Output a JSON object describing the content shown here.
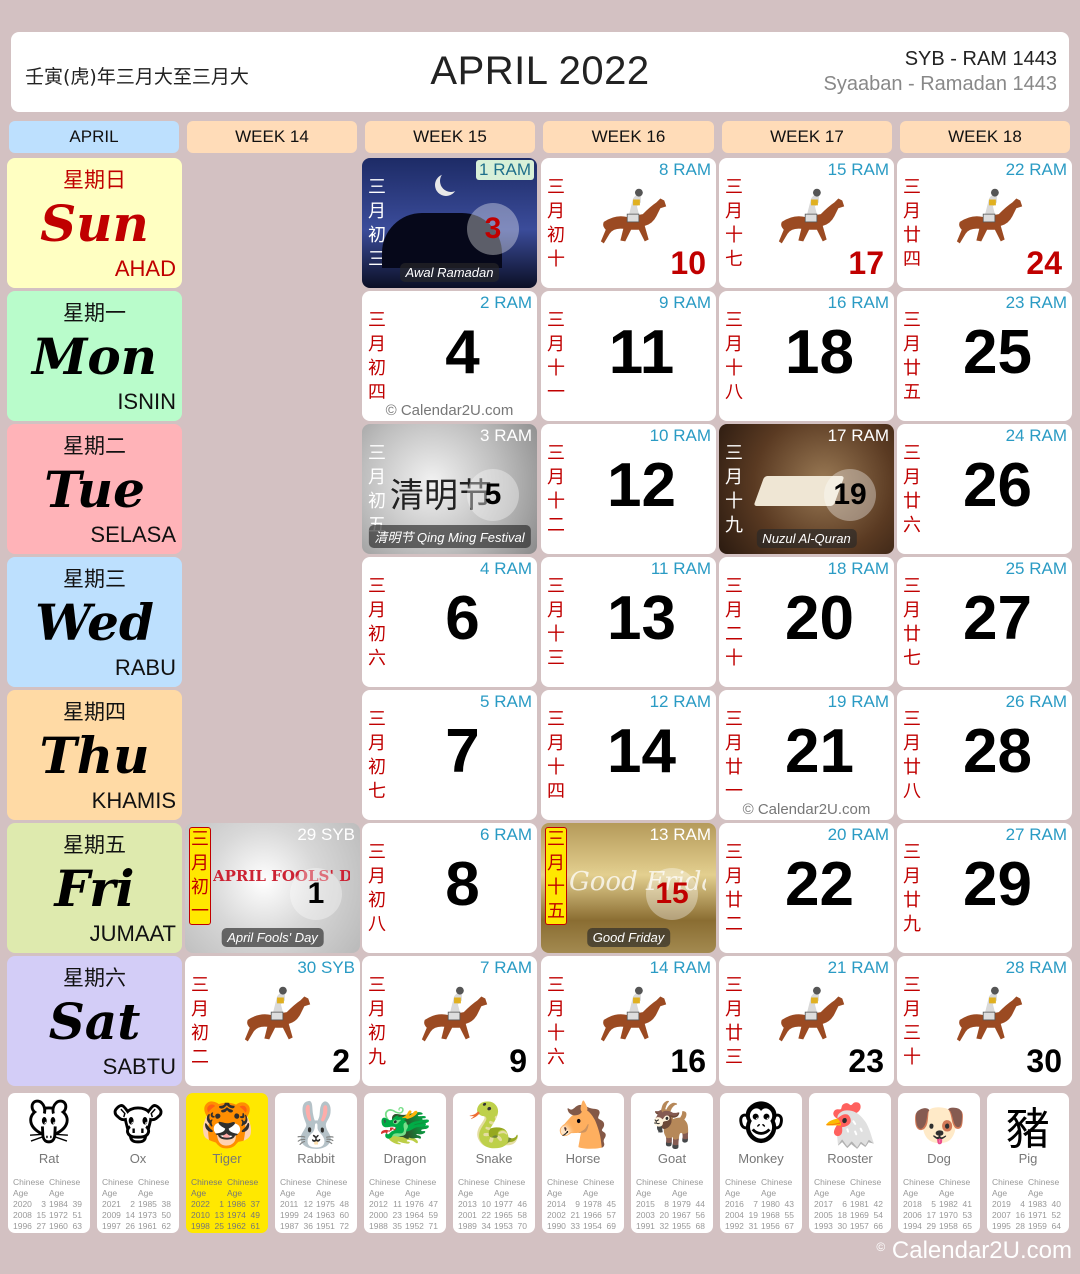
{
  "header": {
    "chinese_year": "壬寅(虎)年三月大至三月大",
    "title": "APRIL 2022",
    "hijri_short": "SYB - RAM 1443",
    "hijri_long": "Syaaban - Ramadan 1443"
  },
  "columns": [
    "APRIL",
    "WEEK 14",
    "WEEK 15",
    "WEEK 16",
    "WEEK 17",
    "WEEK 18"
  ],
  "days": [
    {
      "cn": "星期日",
      "en": "Sun",
      "ms": "AHAD",
      "color": "#ffffc2"
    },
    {
      "cn": "星期一",
      "en": "Mon",
      "ms": "ISNIN",
      "color": "#b9fccb"
    },
    {
      "cn": "星期二",
      "en": "Tue",
      "ms": "SELASA",
      "color": "#ffb3b8"
    },
    {
      "cn": "星期三",
      "en": "Wed",
      "ms": "RABU",
      "color": "#bde0fe"
    },
    {
      "cn": "星期四",
      "en": "Thu",
      "ms": "KHAMIS",
      "color": "#ffdaa5"
    },
    {
      "cn": "星期五",
      "en": "Fri",
      "ms": "JUMAAT",
      "color": "#deeaae"
    },
    {
      "cn": "星期六",
      "en": "Sat",
      "ms": "SABTU",
      "color": "#d3cdf7"
    }
  ],
  "cells": {
    "w15_sun": {
      "day": "3",
      "hijri": "1 RAM",
      "lunar": [
        "三",
        "月",
        "初",
        "三"
      ],
      "caption": "Awal Ramadan"
    },
    "w16_sun": {
      "day": "10",
      "hijri": "8 RAM",
      "lunar": [
        "三",
        "月",
        "初",
        "十"
      ]
    },
    "w17_sun": {
      "day": "17",
      "hijri": "15 RAM",
      "lunar": [
        "三",
        "月",
        "十",
        "七"
      ]
    },
    "w18_sun": {
      "day": "24",
      "hijri": "22 RAM",
      "lunar": [
        "三",
        "月",
        "廿",
        "四"
      ]
    },
    "w15_mon": {
      "day": "4",
      "hijri": "2 RAM",
      "lunar": [
        "三",
        "月",
        "初",
        "四"
      ],
      "watermark": "© Calendar2U.com"
    },
    "w16_mon": {
      "day": "11",
      "hijri": "9 RAM",
      "lunar": [
        "三",
        "月",
        "十",
        "一"
      ]
    },
    "w17_mon": {
      "day": "18",
      "hijri": "16 RAM",
      "lunar": [
        "三",
        "月",
        "十",
        "八"
      ]
    },
    "w18_mon": {
      "day": "25",
      "hijri": "23 RAM",
      "lunar": [
        "三",
        "月",
        "廿",
        "五"
      ]
    },
    "w15_tue": {
      "day": "5",
      "hijri": "3 RAM",
      "lunar": [
        "三",
        "月",
        "初",
        "五"
      ],
      "caption": "清明节 Qing Ming Festival",
      "art": "清明节"
    },
    "w16_tue": {
      "day": "12",
      "hijri": "10 RAM",
      "lunar": [
        "三",
        "月",
        "十",
        "二"
      ]
    },
    "w17_tue": {
      "day": "19",
      "hijri": "17 RAM",
      "lunar": [
        "三",
        "月",
        "十",
        "九"
      ],
      "caption": "Nuzul Al-Quran"
    },
    "w18_tue": {
      "day": "26",
      "hijri": "24 RAM",
      "lunar": [
        "三",
        "月",
        "廿",
        "六"
      ]
    },
    "w15_wed": {
      "day": "6",
      "hijri": "4 RAM",
      "lunar": [
        "三",
        "月",
        "初",
        "六"
      ]
    },
    "w16_wed": {
      "day": "13",
      "hijri": "11 RAM",
      "lunar": [
        "三",
        "月",
        "十",
        "三"
      ]
    },
    "w17_wed": {
      "day": "20",
      "hijri": "18 RAM",
      "lunar": [
        "三",
        "月",
        "二",
        "十"
      ]
    },
    "w18_wed": {
      "day": "27",
      "hijri": "25 RAM",
      "lunar": [
        "三",
        "月",
        "廿",
        "七"
      ]
    },
    "w15_thu": {
      "day": "7",
      "hijri": "5 RAM",
      "lunar": [
        "三",
        "月",
        "初",
        "七"
      ]
    },
    "w16_thu": {
      "day": "14",
      "hijri": "12 RAM",
      "lunar": [
        "三",
        "月",
        "十",
        "四"
      ]
    },
    "w17_thu": {
      "day": "21",
      "hijri": "19 RAM",
      "lunar": [
        "三",
        "月",
        "廿",
        "一"
      ],
      "watermark": "© Calendar2U.com"
    },
    "w18_thu": {
      "day": "28",
      "hijri": "26 RAM",
      "lunar": [
        "三",
        "月",
        "廿",
        "八"
      ]
    },
    "w14_fri": {
      "day": "1",
      "hijri": "29 SYB",
      "lunar": [
        "三",
        "月",
        "初",
        "一"
      ],
      "caption": "April Fools' Day",
      "art": "APRIL FOOLS' DAY"
    },
    "w15_fri": {
      "day": "8",
      "hijri": "6 RAM",
      "lunar": [
        "三",
        "月",
        "初",
        "八"
      ]
    },
    "w16_fri": {
      "day": "15",
      "hijri": "13 RAM",
      "lunar": [
        "三",
        "月",
        "十",
        "五"
      ],
      "caption": "Good Friday",
      "art": "Good Friday"
    },
    "w17_fri": {
      "day": "22",
      "hijri": "20 RAM",
      "lunar": [
        "三",
        "月",
        "廿",
        "二"
      ]
    },
    "w18_fri": {
      "day": "29",
      "hijri": "27 RAM",
      "lunar": [
        "三",
        "月",
        "廿",
        "九"
      ]
    },
    "w14_sat": {
      "day": "2",
      "hijri": "30 SYB",
      "lunar": [
        "三",
        "月",
        "初",
        "二"
      ]
    },
    "w15_sat": {
      "day": "9",
      "hijri": "7 RAM",
      "lunar": [
        "三",
        "月",
        "初",
        "九"
      ]
    },
    "w16_sat": {
      "day": "16",
      "hijri": "14 RAM",
      "lunar": [
        "三",
        "月",
        "十",
        "六"
      ]
    },
    "w17_sat": {
      "day": "23",
      "hijri": "21 RAM",
      "lunar": [
        "三",
        "月",
        "廿",
        "三"
      ]
    },
    "w18_sat": {
      "day": "30",
      "hijri": "28 RAM",
      "lunar": [
        "三",
        "月",
        "三",
        "十"
      ]
    }
  },
  "zodiac": {
    "header": [
      "Chinese",
      "Age",
      "Chinese",
      "Age"
    ],
    "active": "Tiger",
    "animals": [
      {
        "name": "Rat",
        "glyph": "🐭",
        "rows": [
          [
            "2020",
            "3",
            "1984",
            "39"
          ],
          [
            "2008",
            "15",
            "1972",
            "51"
          ],
          [
            "1996",
            "27",
            "1960",
            "63"
          ]
        ]
      },
      {
        "name": "Ox",
        "glyph": "🐮",
        "rows": [
          [
            "2021",
            "2",
            "1985",
            "38"
          ],
          [
            "2009",
            "14",
            "1973",
            "50"
          ],
          [
            "1997",
            "26",
            "1961",
            "62"
          ]
        ]
      },
      {
        "name": "Tiger",
        "glyph": "🐯",
        "rows": [
          [
            "2022",
            "1",
            "1986",
            "37"
          ],
          [
            "2010",
            "13",
            "1974",
            "49"
          ],
          [
            "1998",
            "25",
            "1962",
            "61"
          ]
        ]
      },
      {
        "name": "Rabbit",
        "glyph": "🐰",
        "rows": [
          [
            "2011",
            "12",
            "1975",
            "48"
          ],
          [
            "1999",
            "24",
            "1963",
            "60"
          ],
          [
            "1987",
            "36",
            "1951",
            "72"
          ]
        ]
      },
      {
        "name": "Dragon",
        "glyph": "🐲",
        "rows": [
          [
            "2012",
            "11",
            "1976",
            "47"
          ],
          [
            "2000",
            "23",
            "1964",
            "59"
          ],
          [
            "1988",
            "35",
            "1952",
            "71"
          ]
        ]
      },
      {
        "name": "Snake",
        "glyph": "🐍",
        "rows": [
          [
            "2013",
            "10",
            "1977",
            "46"
          ],
          [
            "2001",
            "22",
            "1965",
            "58"
          ],
          [
            "1989",
            "34",
            "1953",
            "70"
          ]
        ]
      },
      {
        "name": "Horse",
        "glyph": "🐴",
        "rows": [
          [
            "2014",
            "9",
            "1978",
            "45"
          ],
          [
            "2002",
            "21",
            "1966",
            "57"
          ],
          [
            "1990",
            "33",
            "1954",
            "69"
          ]
        ]
      },
      {
        "name": "Goat",
        "glyph": "🐐",
        "rows": [
          [
            "2015",
            "8",
            "1979",
            "44"
          ],
          [
            "2003",
            "20",
            "1967",
            "56"
          ],
          [
            "1991",
            "32",
            "1955",
            "68"
          ]
        ]
      },
      {
        "name": "Monkey",
        "glyph": "🐵",
        "rows": [
          [
            "2016",
            "7",
            "1980",
            "43"
          ],
          [
            "2004",
            "19",
            "1968",
            "55"
          ],
          [
            "1992",
            "31",
            "1956",
            "67"
          ]
        ]
      },
      {
        "name": "Rooster",
        "glyph": "🐔",
        "rows": [
          [
            "2017",
            "6",
            "1981",
            "42"
          ],
          [
            "2005",
            "18",
            "1969",
            "54"
          ],
          [
            "1993",
            "30",
            "1957",
            "66"
          ]
        ]
      },
      {
        "name": "Dog",
        "glyph": "🐶",
        "rows": [
          [
            "2018",
            "5",
            "1982",
            "41"
          ],
          [
            "2006",
            "17",
            "1970",
            "53"
          ],
          [
            "1994",
            "29",
            "1958",
            "65"
          ]
        ]
      },
      {
        "name": "Pig",
        "glyph": "豬",
        "rows": [
          [
            "2019",
            "4",
            "1983",
            "40"
          ],
          [
            "2007",
            "16",
            "1971",
            "52"
          ],
          [
            "1995",
            "28",
            "1959",
            "64"
          ]
        ]
      }
    ]
  },
  "footer": {
    "copyright_symbol": "©",
    "site": "Calendar2U.com"
  },
  "colors": {
    "hijri_blue": "#2a9bc4",
    "lunar_red": "#c00000",
    "background": "#d3c1c2",
    "week_header": "#ffdcb8",
    "month_header": "#bde0fe",
    "tiger_highlight": "#ffe800"
  }
}
